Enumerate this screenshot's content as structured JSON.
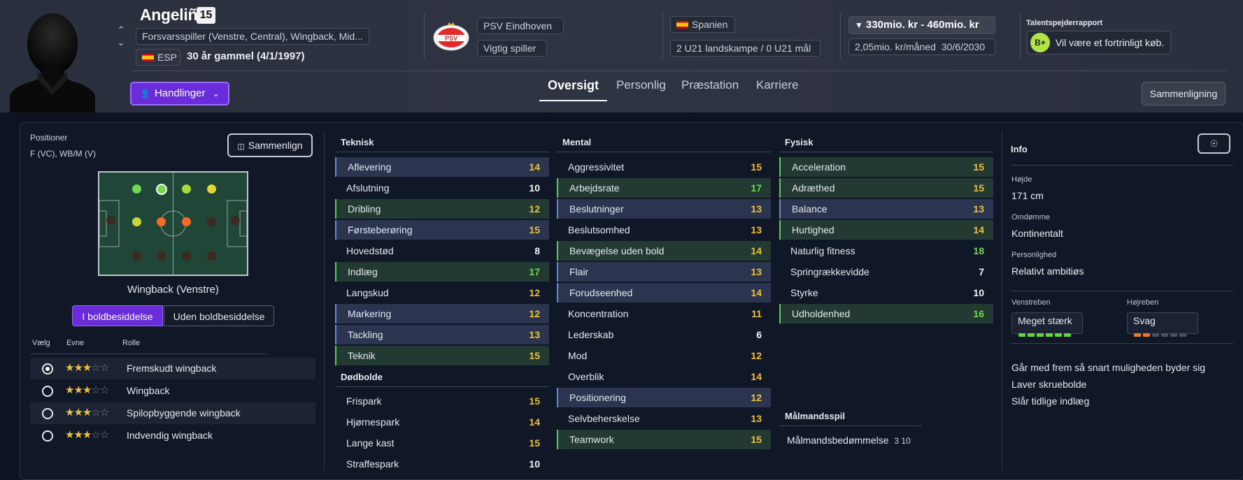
{
  "player": {
    "name": "Angeliño",
    "number": "15",
    "position": "Forsvarsspiller (Venstre, Central), Wingback, Mid...",
    "nationality": "ESP",
    "age": "30 år gammel (4/1/1997)",
    "actions_label": "Handlinger"
  },
  "club": {
    "name": "PSV Eindhoven",
    "status": "Vigtig spiller",
    "logo_text": "PSV"
  },
  "country": {
    "name": "Spanien",
    "u21": "2 U21 landskampe / 0 U21 mål"
  },
  "value": {
    "range": "330mio. kr - 460mio. kr",
    "wage": "2,05mio. kr/måned",
    "contract": "30/6/2030"
  },
  "scout": {
    "title": "Talentspejderrapport",
    "grade": "B+",
    "text": "Vil være et fortrinligt køb."
  },
  "tabs": [
    "Oversigt",
    "Personlig",
    "Præstation",
    "Karriere"
  ],
  "compare_button": "Sammenligning",
  "positions": {
    "label": "Positioner",
    "value": "F (VC), WB/M (V)",
    "compare_button": "Sammenlign",
    "selected_role_position": "Wingback (Venstre)",
    "toggle_in": "I boldbesiddelse",
    "toggle_out": "Uden boldbesiddelse",
    "headers": [
      "Vælg",
      "Evne",
      "Rolle"
    ],
    "roles": [
      {
        "name": "Fremskudt wingback",
        "stars": 3,
        "selected": true
      },
      {
        "name": "Wingback",
        "stars": 3,
        "selected": false
      },
      {
        "name": "Spilopbyggende wingback",
        "stars": 3,
        "selected": false
      },
      {
        "name": "Indvendig wingback",
        "stars": 3,
        "selected": false
      }
    ]
  },
  "technical": {
    "title": "Teknisk",
    "items": [
      {
        "name": "Aflevering",
        "value": "14",
        "hl": "blue"
      },
      {
        "name": "Afslutning",
        "value": "10",
        "hl": ""
      },
      {
        "name": "Dribling",
        "value": "12",
        "hl": "green"
      },
      {
        "name": "Førsteberøring",
        "value": "15",
        "hl": "blue"
      },
      {
        "name": "Hovedstød",
        "value": "8",
        "hl": ""
      },
      {
        "name": "Indlæg",
        "value": "17",
        "hl": "green"
      },
      {
        "name": "Langskud",
        "value": "12",
        "hl": ""
      },
      {
        "name": "Markering",
        "value": "12",
        "hl": "blue"
      },
      {
        "name": "Tackling",
        "value": "13",
        "hl": "blue"
      },
      {
        "name": "Teknik",
        "value": "15",
        "hl": "green"
      }
    ]
  },
  "setpieces": {
    "title": "Dødbolde",
    "items": [
      {
        "name": "Frispark",
        "value": "15",
        "hl": ""
      },
      {
        "name": "Hjørnespark",
        "value": "14",
        "hl": ""
      },
      {
        "name": "Lange kast",
        "value": "15",
        "hl": ""
      },
      {
        "name": "Straffespark",
        "value": "10",
        "hl": ""
      }
    ]
  },
  "mental": {
    "title": "Mental",
    "items": [
      {
        "name": "Aggressivitet",
        "value": "15",
        "hl": ""
      },
      {
        "name": "Arbejdsrate",
        "value": "17",
        "hl": "green"
      },
      {
        "name": "Beslutninger",
        "value": "13",
        "hl": "blue"
      },
      {
        "name": "Beslutsomhed",
        "value": "13",
        "hl": ""
      },
      {
        "name": "Bevægelse uden bold",
        "value": "14",
        "hl": "green"
      },
      {
        "name": "Flair",
        "value": "13",
        "hl": "blue"
      },
      {
        "name": "Forudseenhed",
        "value": "14",
        "hl": "blue"
      },
      {
        "name": "Koncentration",
        "value": "11",
        "hl": ""
      },
      {
        "name": "Lederskab",
        "value": "6",
        "hl": ""
      },
      {
        "name": "Mod",
        "value": "12",
        "hl": ""
      },
      {
        "name": "Overblik",
        "value": "14",
        "hl": ""
      },
      {
        "name": "Positionering",
        "value": "12",
        "hl": "blue"
      },
      {
        "name": "Selvbeherskelse",
        "value": "13",
        "hl": ""
      },
      {
        "name": "Teamwork",
        "value": "15",
        "hl": "green"
      }
    ]
  },
  "physical": {
    "title": "Fysisk",
    "items": [
      {
        "name": "Acceleration",
        "value": "15",
        "hl": "green"
      },
      {
        "name": "Adræthed",
        "value": "15",
        "hl": "green"
      },
      {
        "name": "Balance",
        "value": "13",
        "hl": "blue"
      },
      {
        "name": "Hurtighed",
        "value": "14",
        "hl": "green"
      },
      {
        "name": "Naturlig fitness",
        "value": "18",
        "hl": ""
      },
      {
        "name": "Springrækkevidde",
        "value": "7",
        "hl": ""
      },
      {
        "name": "Styrke",
        "value": "10",
        "hl": ""
      },
      {
        "name": "Udholdenhed",
        "value": "16",
        "hl": "green"
      }
    ]
  },
  "goalkeeping": {
    "title": "Målmandsspil",
    "label": "Målmandsbedømmelse",
    "value": "3 10"
  },
  "info": {
    "title": "Info",
    "height_label": "Højde",
    "height": "171 cm",
    "reputation_label": "Omdømme",
    "reputation": "Kontinentalt",
    "personality_label": "Personlighed",
    "personality": "Relativt ambitiøs",
    "left_foot_label": "Venstreben",
    "left_foot": "Meget stærk",
    "left_foot_level": 5,
    "right_foot_label": "Højreben",
    "right_foot": "Svag",
    "right_foot_level": 2,
    "traits": [
      "Går med frem så snart muligheden byder sig",
      "Laver skruebolde",
      "Slår tidlige indlæg"
    ]
  }
}
